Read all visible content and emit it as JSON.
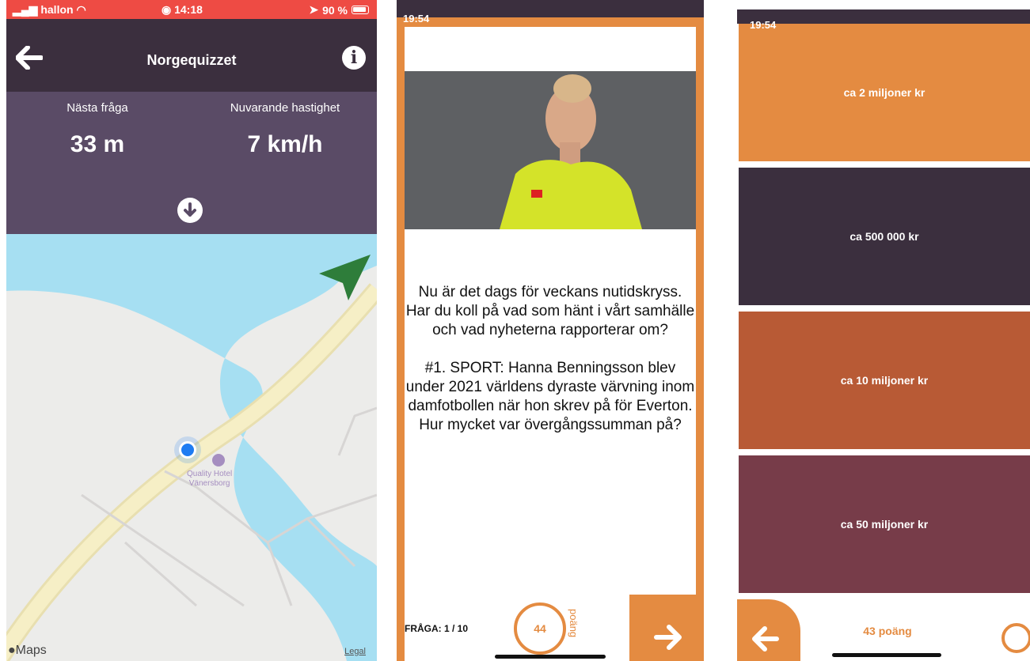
{
  "screen1": {
    "status": {
      "carrier": "hallon",
      "time": "14:18",
      "battery": "90 %"
    },
    "nav": {
      "title": "Norgequizzet",
      "back_icon": "back-arrow-icon",
      "info_icon": "info-icon"
    },
    "stats": {
      "next_label": "Nästa fråga",
      "next_value": "33 m",
      "speed_label": "Nuvarande hastighet",
      "speed_value": "7 km/h"
    },
    "map": {
      "poi_line1": "Quality Hotel",
      "poi_line2": "Vänersborg",
      "attribution": "Maps",
      "legal": "Legal"
    }
  },
  "screen2": {
    "status": {
      "time": "19:54"
    },
    "question": {
      "intro": "Nu är det dags för veckans nutidskryss. Har du koll på vad som hänt i vårt samhälle och vad nyheterna rapporterar om?",
      "body": "#1. SPORT: Hanna Benningsson blev under 2021 världens dyraste värvning inom damfotbollen när hon skrev på för Everton. Hur mycket var övergångssumman på?"
    },
    "footer": {
      "progress": "FRÅGA: 1 / 10",
      "score": "44",
      "score_unit": "poäng"
    }
  },
  "screen3": {
    "status": {
      "time": "19:54"
    },
    "answers": [
      {
        "label": "ca 2 miljoner kr",
        "color": "#e48b41"
      },
      {
        "label": "ca 500 000 kr",
        "color": "#3b2f3e"
      },
      {
        "label": "ca 10 miljoner kr",
        "color": "#b85a35"
      },
      {
        "label": "ca 50 miljoner kr",
        "color": "#773c49"
      }
    ],
    "footer": {
      "score": "43 poäng"
    }
  },
  "colors": {
    "orange": "#e48b41",
    "plum": "#3b2f3e",
    "status_red": "#ee4b44"
  }
}
